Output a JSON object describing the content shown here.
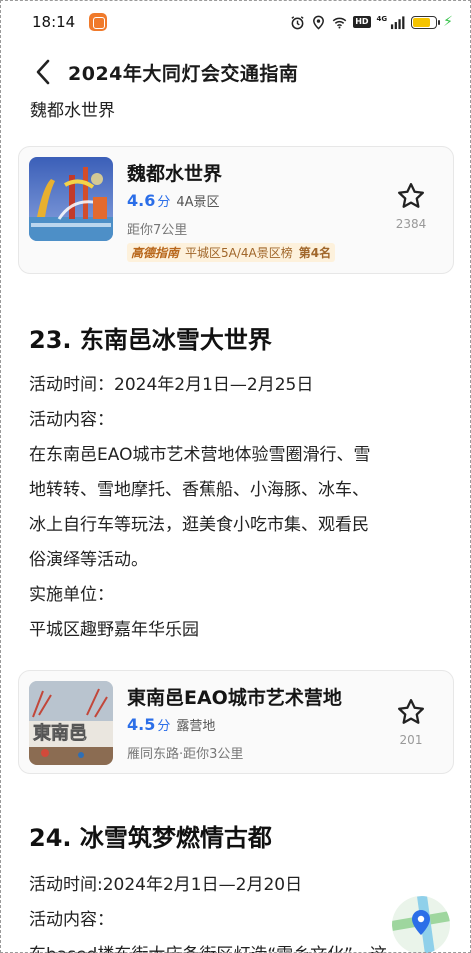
{
  "status_bar": {
    "time": "18:14",
    "hd": "HD",
    "signal_label": "4G",
    "battery_level": 0.75,
    "icons": [
      "app-notification-icon",
      "alarm-icon",
      "location-icon",
      "wifi-icon",
      "hd-icon",
      "signal-icon",
      "battery-icon",
      "charging-icon"
    ]
  },
  "header": {
    "title": "2024年大同灯会交通指南",
    "back_icon": "chevron-left-icon"
  },
  "article": {
    "prev_tail": "魏都水世界",
    "card1": {
      "name": "魏都水世界",
      "score": "4.6",
      "score_unit": "分",
      "type": "4A景区",
      "distance": "距你7公里",
      "rank_tag": "高德指南",
      "rank_text": "平城区5A/4A景区榜",
      "rank_pos": "第4名",
      "fav_count": "2384"
    },
    "section23": {
      "title": "23. 东南邑冰雪大世界",
      "lines": [
        "活动时间：2024年2月1日—2月25日",
        "活动内容：",
        "在东南邑EAO城市艺术营地体验雪圈滑行、雪",
        "地转转、雪地摩托、香蕉船、小海豚、冰车、",
        "冰上自行车等玩法，逛美食小吃市集、观看民",
        "俗演绎等活动。",
        "实施单位：",
        "平城区趣野嘉年华乐园"
      ]
    },
    "card2": {
      "name": "東南邑EAO城市艺术营地",
      "score": "4.5",
      "score_unit": "分",
      "type": "露营地",
      "distance": "雁同东路·距你3公里",
      "fav_count": "201"
    },
    "section24": {
      "title": "24. 冰雪筑梦燃情古都",
      "lines": [
        "活动时间:2024年2月1日—2月20日",
        "活动内容：",
        "东based楼东街大庆备街区灯造“雪乡文化”，这"
      ]
    }
  },
  "floating_map_button": {
    "icon": "map-pin-icon"
  },
  "colors": {
    "accent_blue": "#2b6ee8",
    "rank_bg": "#fdf1dc",
    "rank_text": "#a0662a",
    "battery": "#f5c400",
    "charging": "#36c24a"
  }
}
